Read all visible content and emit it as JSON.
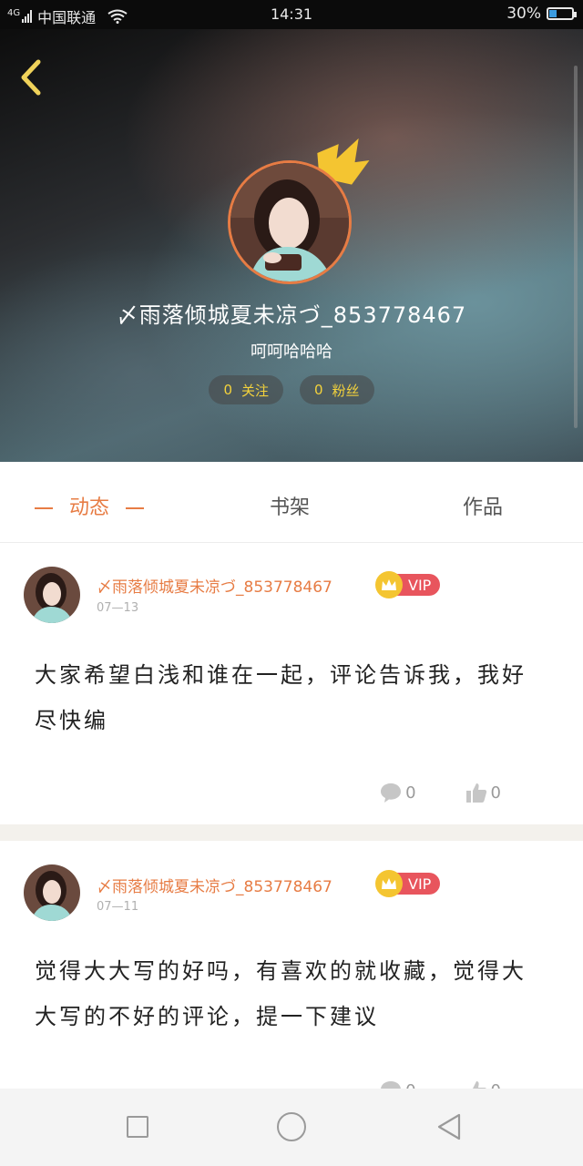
{
  "status_bar": {
    "network": "4G",
    "carrier": "中国联通",
    "time": "14:31",
    "battery_percent": "30%",
    "battery_level": 0.3
  },
  "profile": {
    "username": "〆雨落倾城夏未凉づ_853778467",
    "signature": "呵呵哈哈哈",
    "following_count": "0",
    "following_label": "关注",
    "fans_count": "0",
    "fans_label": "粉丝"
  },
  "tabs": [
    {
      "label": "动态",
      "active": true
    },
    {
      "label": "书架",
      "active": false
    },
    {
      "label": "作品",
      "active": false
    }
  ],
  "posts": [
    {
      "author": "〆雨落倾城夏未凉づ_853778467",
      "badge": "VIP",
      "date": "07—13",
      "text": "大家希望白浅和谁在一起，评论告诉我，我好尽快编",
      "comments": "0",
      "likes": "0"
    },
    {
      "author": "〆雨落倾城夏未凉づ_853778467",
      "badge": "VIP",
      "date": "07—11",
      "text": "觉得大大写的好吗，有喜欢的就收藏，觉得大大写的不好的评论，提一下建议",
      "comments": "0",
      "likes": "0"
    }
  ],
  "colors": {
    "accent": "#e77c44",
    "vip_red": "#e8555d",
    "crown_yellow": "#f4c531",
    "pill_text": "#f3d23c"
  },
  "icons": [
    "back-chevron-icon",
    "crown-icon",
    "comment-icon",
    "thumbs-up-icon",
    "wifi-icon",
    "battery-icon",
    "signal-icon"
  ]
}
